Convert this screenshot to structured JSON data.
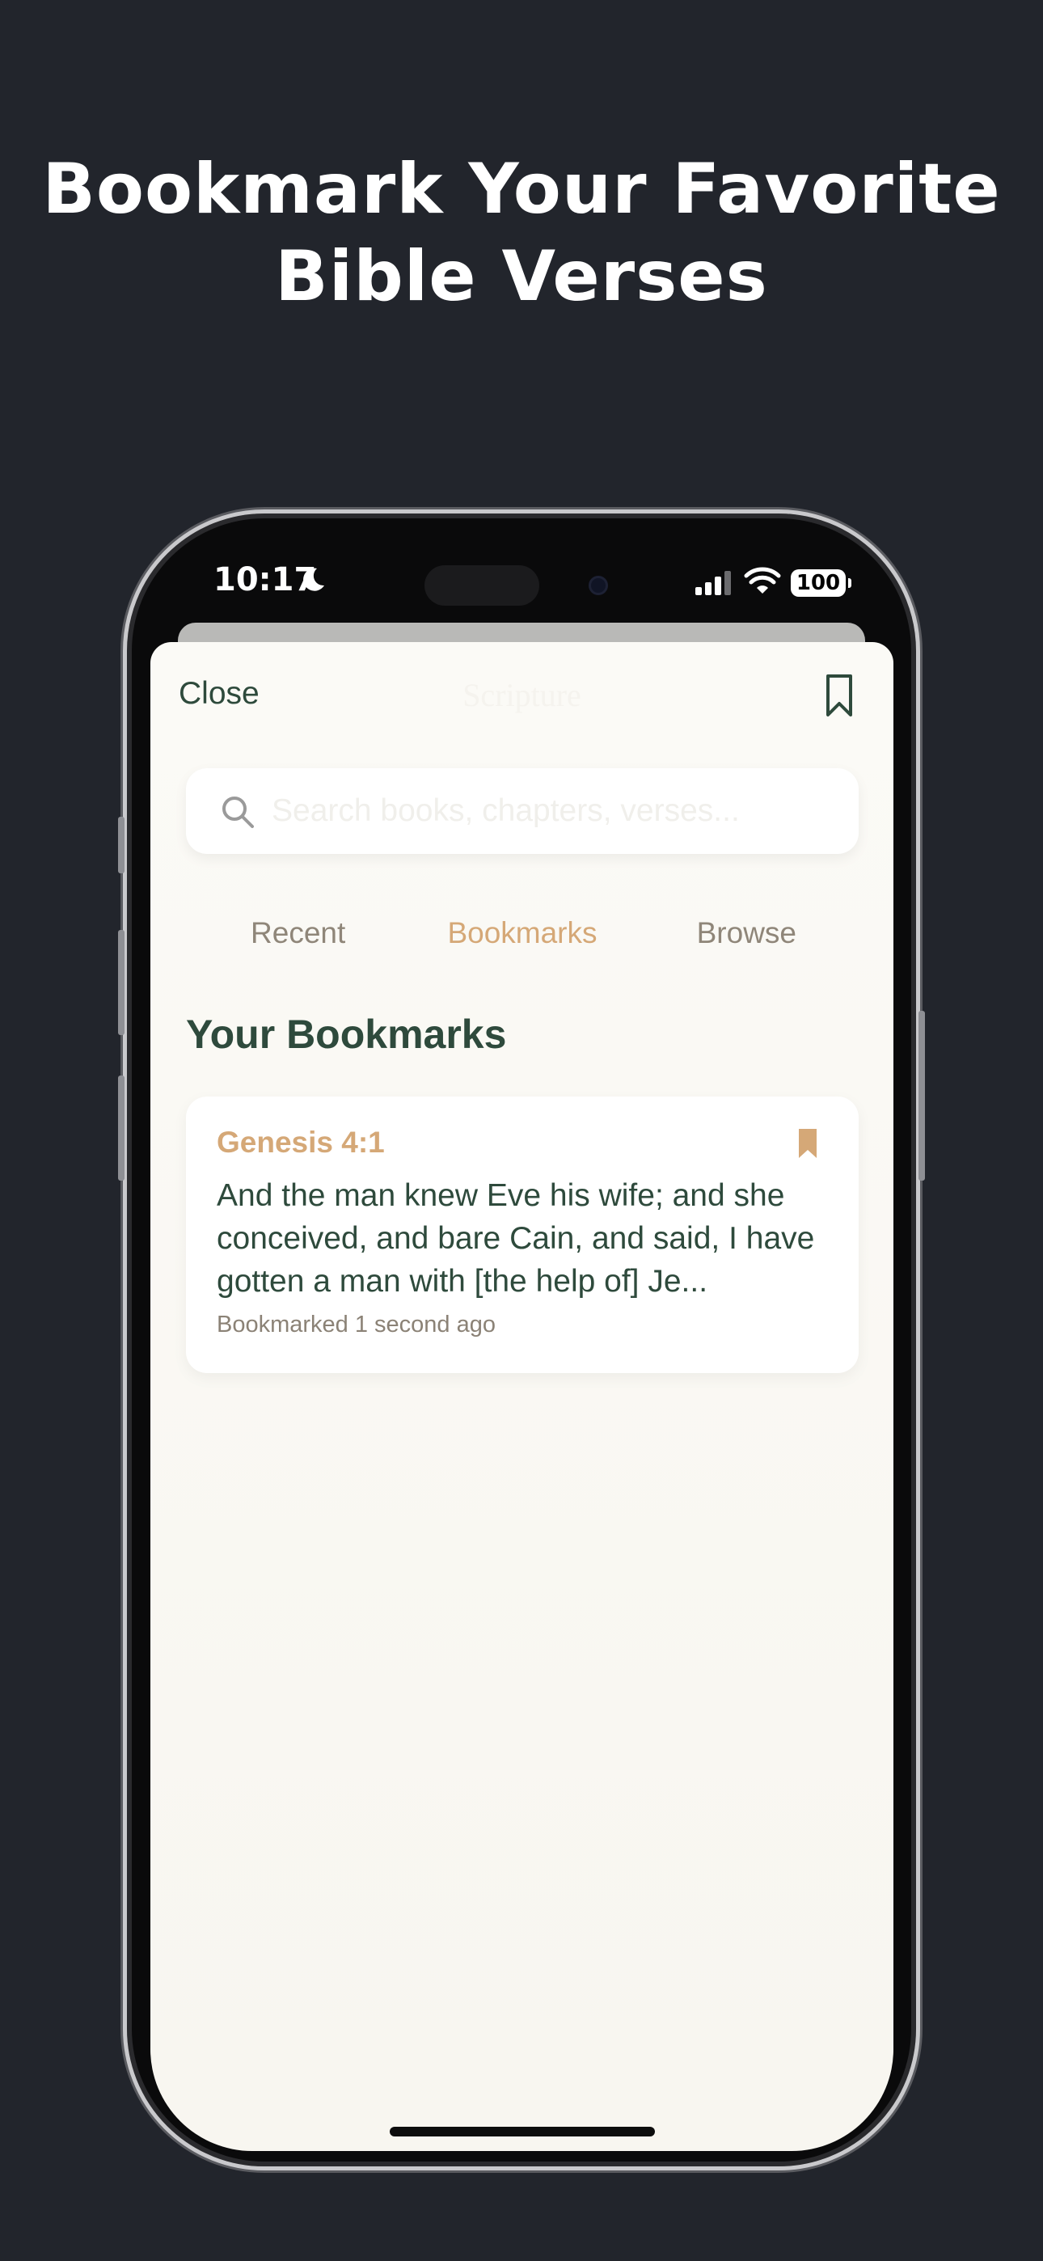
{
  "headline": {
    "line1": "Bookmark Your Favorite",
    "line2": "Bible Verses"
  },
  "status_bar": {
    "time": "10:17",
    "battery": "100"
  },
  "nav": {
    "close_label": "Close",
    "title": "Scripture"
  },
  "search": {
    "placeholder": "Search books, chapters, verses..."
  },
  "tabs": [
    {
      "label": "Recent",
      "active": false
    },
    {
      "label": "Bookmarks",
      "active": true
    },
    {
      "label": "Browse",
      "active": false
    }
  ],
  "section_title": "Your Bookmarks",
  "bookmarks": [
    {
      "reference": "Genesis 4:1",
      "text": "And the man knew Eve his wife; and she conceived, and bare Cain, and said, I have gotten a man with [the help of] Je...",
      "meta": "Bookmarked 1 second ago"
    }
  ],
  "colors": {
    "background": "#22252c",
    "accent_gold": "#d5a877",
    "primary_green": "#2e4a3c",
    "muted": "#8f8679",
    "screen_bg": "#fbfaf6"
  }
}
